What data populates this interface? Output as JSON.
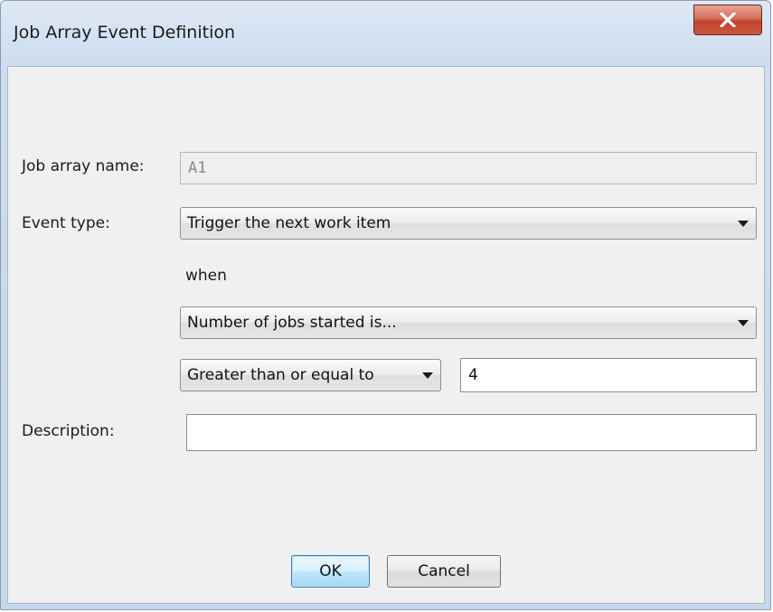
{
  "window": {
    "title": "Job Array Event Definition",
    "close_icon": "close-x-icon"
  },
  "form": {
    "job_array_name_label": "Job array name:",
    "job_array_name_value": "A1",
    "event_type_label": "Event type:",
    "event_type_value": "Trigger the next work item",
    "when_label": "when",
    "condition_value": "Number of jobs started is...",
    "comparator_value": "Greater than or equal to",
    "threshold_value": "4",
    "description_label": "Description:",
    "description_value": ""
  },
  "buttons": {
    "ok_label": "OK",
    "cancel_label": "Cancel"
  },
  "colors": {
    "title_bar": "#cddcef",
    "close_button": "#c9573e",
    "client_background": "#f0f0f0",
    "default_button_border": "#3c7fb1"
  }
}
